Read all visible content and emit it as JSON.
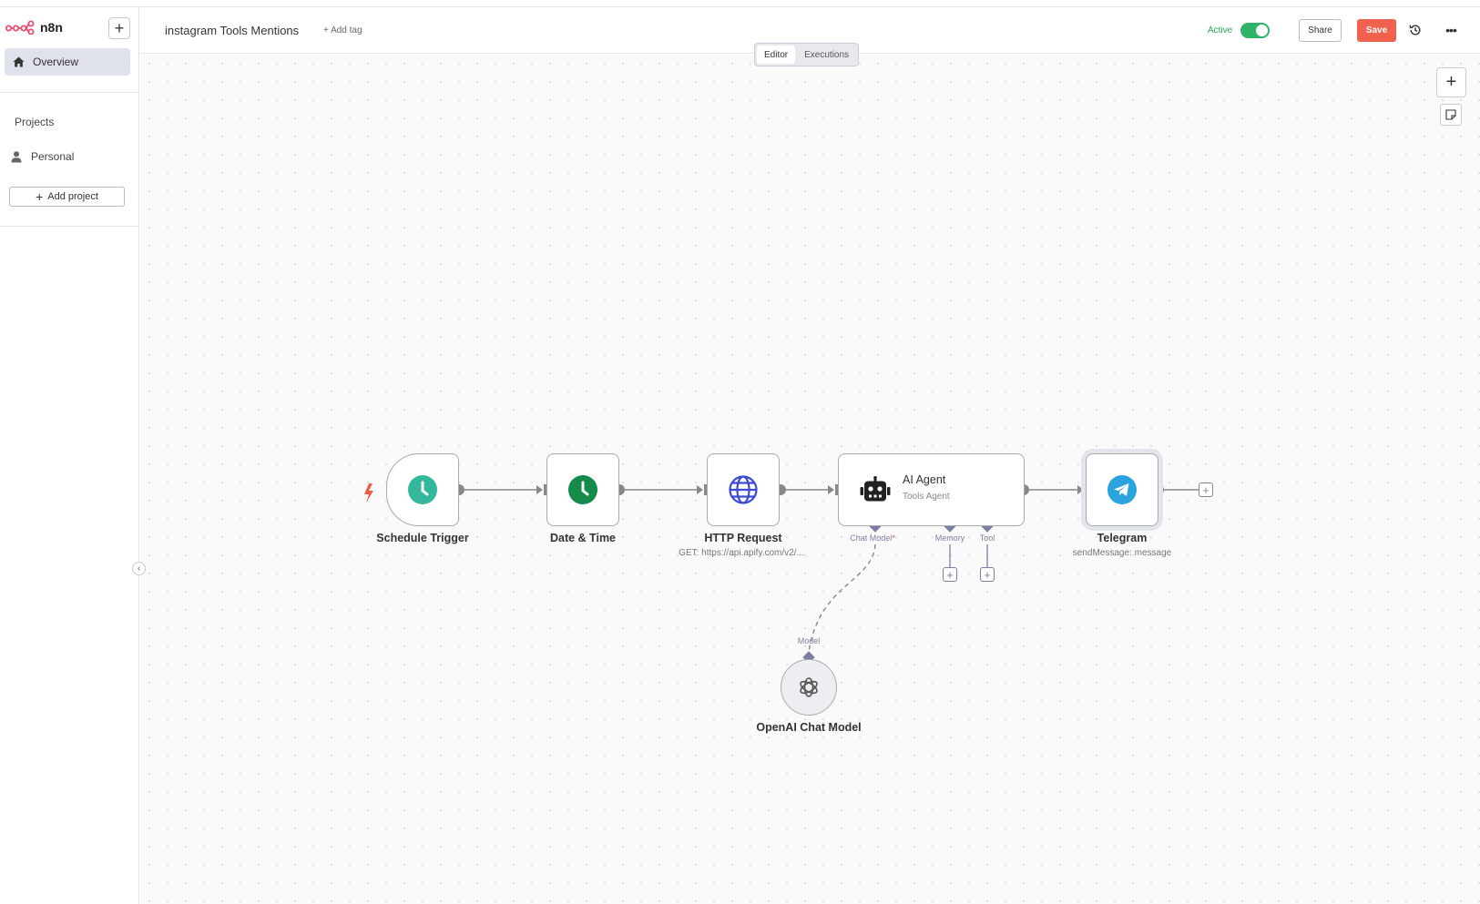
{
  "app": {
    "logo_text": "n8n"
  },
  "sidebar": {
    "overview_label": "Overview",
    "projects_heading": "Projects",
    "personal_label": "Personal",
    "add_project_label": "Add project"
  },
  "header": {
    "workflow_name": "instagram Tools Mentions",
    "add_tag_label": "+ Add tag",
    "active_label": "Active",
    "active": true,
    "share_label": "Share",
    "save_label": "Save"
  },
  "tabs": [
    {
      "label": "Editor",
      "active": true
    },
    {
      "label": "Executions",
      "active": false
    }
  ],
  "nodes": {
    "schedule_trigger": {
      "label": "Schedule Trigger",
      "icon": "clock-icon"
    },
    "date_time": {
      "label": "Date & Time",
      "icon": "clock-icon"
    },
    "http_request": {
      "label": "HTTP Request",
      "subtitle": "GET: https://api.apify.com/v2/...",
      "icon": "globe-icon"
    },
    "ai_agent": {
      "label": "AI Agent",
      "subtitle": "Tools Agent",
      "icon": "robot-icon"
    },
    "telegram": {
      "label": "Telegram",
      "subtitle": "sendMessage: message",
      "icon": "telegram-icon"
    },
    "openai_chat_model": {
      "label": "OpenAI Chat Model",
      "icon": "openai-icon"
    }
  },
  "ports": {
    "chat_model": "Chat Model",
    "chat_model_required": "*",
    "memory": "Memory",
    "tool": "Tool",
    "model": "Model"
  },
  "colors": {
    "accent_save": "#f0624d",
    "active_green": "#2eb36a",
    "schedule_teal": "#34b89b",
    "datetime_green": "#148a4b",
    "http_blue": "#3b4bd6",
    "telegram_blue": "#2aa3df",
    "port_purple": "#7b7fa3"
  }
}
